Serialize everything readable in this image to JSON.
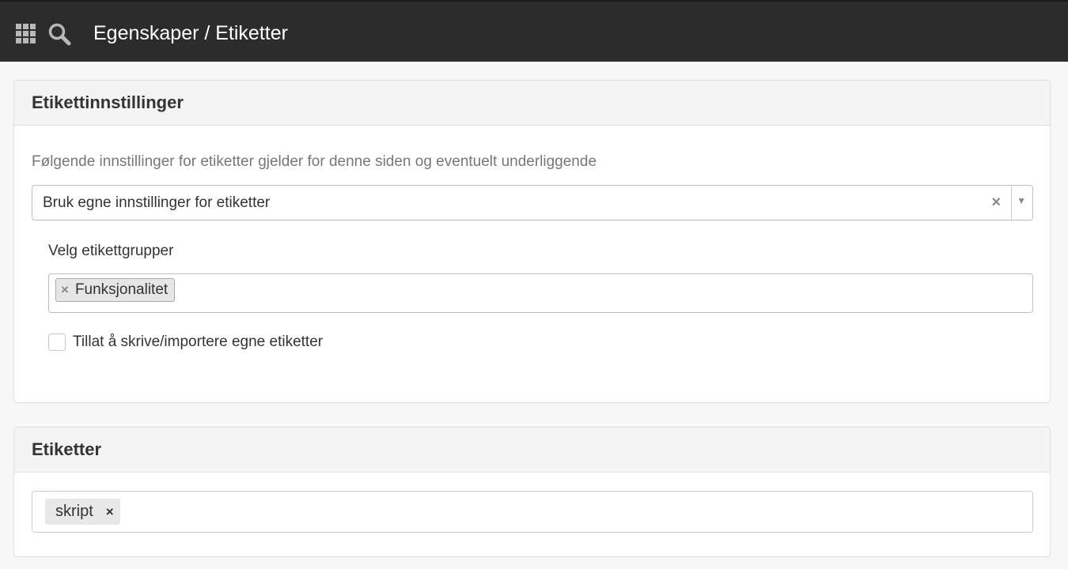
{
  "header": {
    "title": "Egenskaper / Etiketter",
    "icons": [
      "apps-grid-icon",
      "search-icon"
    ]
  },
  "settings_panel": {
    "title": "Etikettinnstillinger",
    "description": "Følgende innstillinger for etiketter gjelder for denne siden og eventuelt underliggende",
    "select": {
      "value": "Bruk egne innstillinger for etiketter",
      "clear_glyph": "×",
      "arrow_glyph": "▼"
    },
    "groups_label": "Velg etikettgrupper",
    "groups": [
      {
        "label": "Funksjonalitet",
        "remove_glyph": "×"
      }
    ],
    "checkbox": {
      "label": "Tillat å skrive/importere egne etiketter",
      "checked": false
    }
  },
  "tags_panel": {
    "title": "Etiketter",
    "tags": [
      {
        "label": "skript",
        "remove_glyph": "×"
      }
    ]
  },
  "colors": {
    "topbar": "#2c2c2c",
    "background": "#f7f7f7",
    "panel_header": "#f4f4f4"
  }
}
